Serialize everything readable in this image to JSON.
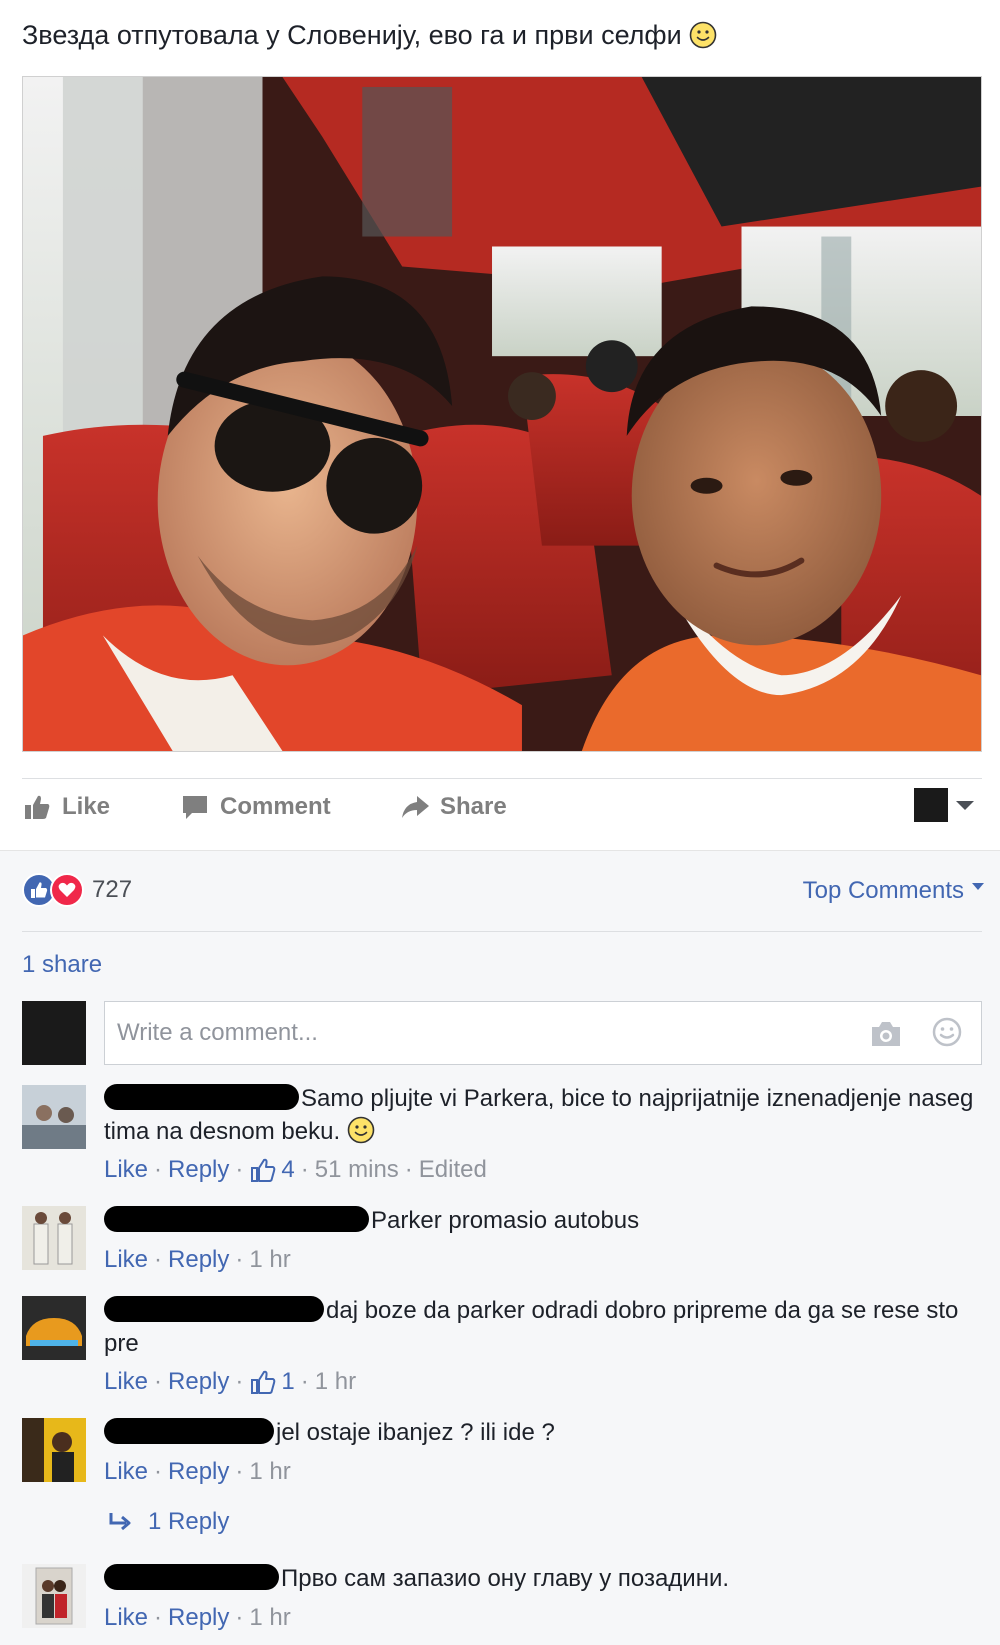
{
  "post": {
    "caption": "Звезда отпутовала у Словенију, ево га и први селфи"
  },
  "actions": {
    "like": "Like",
    "comment": "Comment",
    "share": "Share"
  },
  "reactions": {
    "count": "727",
    "sort_label": "Top Comments"
  },
  "shares": "1 share",
  "composer": {
    "placeholder": "Write a comment..."
  },
  "comments": [
    {
      "text": "Samo pljujte vi Parkera, bice to najprijatnije iznenadjenje naseg tima na desnom beku.",
      "like": "Like",
      "reply": "Reply",
      "likes": "4",
      "time": "51 mins",
      "edited": "Edited"
    },
    {
      "text": "Parker promasio autobus",
      "like": "Like",
      "reply": "Reply",
      "time": "1 hr"
    },
    {
      "text": "daj boze da parker odradi dobro pripreme da ga se rese sto pre",
      "like": "Like",
      "reply": "Reply",
      "likes": "1",
      "time": "1 hr"
    },
    {
      "text": "jel ostaje ibanjez ? ili ide ?",
      "like": "Like",
      "reply": "Reply",
      "time": "1 hr",
      "replies": "1 Reply"
    },
    {
      "text": "Прво сам запазио ону главу у позадини.",
      "like": "Like",
      "reply": "Reply",
      "time": "1 hr"
    }
  ],
  "icons": {
    "like": "thumbs-up-icon",
    "comment": "speech-bubble-icon",
    "share": "share-arrow-icon",
    "camera": "camera-icon",
    "emoji": "emoji-icon",
    "reply_arrow": "reply-arrow-icon",
    "smiley": "smiley-icon"
  },
  "colors": {
    "link": "#4267b2",
    "like_reaction": "#4267b2",
    "love_reaction": "#f0284a",
    "muted": "#90949c",
    "background": "#f6f7f9"
  }
}
